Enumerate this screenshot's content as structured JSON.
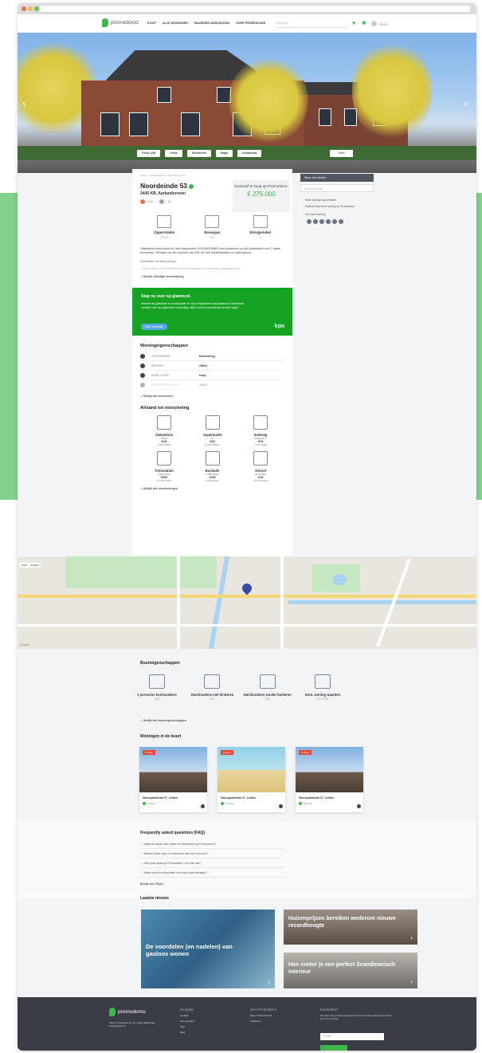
{
  "nav": {
    "logo": "promodomo",
    "menu": [
      "KOOP",
      "ALLE WONINGEN",
      "WAARDEN AANVRAGEN",
      "OVER PROMODOMO"
    ],
    "search_placeholder": "ZOEKEN",
    "account_label": "INLOG"
  },
  "hero": {
    "tabs": [
      "Fotos (25)",
      "Video",
      "Streetview",
      "Maps",
      "Kadastraal"
    ],
    "share": "Delen"
  },
  "listing": {
    "breadcrumb": "Home > Aarlanderveen > Noordeinde > 53",
    "title": "Noordeinde 53",
    "subtitle": "2445 KB, Aarlanderveen",
    "pills": [
      "3 Kls",
      "1 Ks"
    ],
    "price_label": "Exclusief te koop op Promodomo:",
    "price": "€ 275.000",
    "stats": [
      {
        "label": "Oppervlakte",
        "value": "253 m2"
      },
      {
        "label": "Bouwjaar",
        "value": "1912"
      },
      {
        "label": "Energielabel",
        "value": "A"
      }
    ],
    "description": "Uitstekend verbouwde en luxe afgewerkte HOEKWONING met achtertuin op het zuidwesten met 2 fraaie tuinhuizen. Gelegen op een perceel van 253 m2 met parkeerplaats op eigen grond.",
    "desc_head": "Kenmerken van deze woning:",
    "desc_more": "- Vanaf 1909 tot 2019 hebben diverse verbouwingen en renovaties plaatsgevonden",
    "read_more": "Bekijk volledige omschrijving"
  },
  "kpn": {
    "title": "Stap nu over op glasvezel.",
    "body": "Internet via glasvezel is revolutionair. Er zijn al miljoenen huishoudens in Nederland voorzien van een glasvezel verbinding. Wat is dat en wanneerde kennisn slige?",
    "button": "Meer informatie",
    "logo": "kpn"
  },
  "properties": {
    "title": "Woningeigenschappen",
    "rows": [
      {
        "k": "TYPE WONING",
        "v": "Hoekwoning"
      },
      {
        "k": "PERCEEL",
        "v": "253m2"
      },
      {
        "k": "HUUR / KOOP",
        "v": "Koop"
      },
      {
        "k": "WOONOPPERVLAKTE",
        "v": "200m2"
      }
    ],
    "more": "Bekijk alle kenmerken"
  },
  "amenities": {
    "title": "Afstand tot voorziening",
    "items": [
      {
        "name": "Ziekenhuis",
        "sub": "Alrijne",
        "dist": "2KM",
        "time": "3 min fietsen"
      },
      {
        "name": "Supermarkt",
        "sub": "AH",
        "dist": "2KM",
        "time": "6 min fietsen"
      },
      {
        "name": "Snelweg",
        "sub": "Afslag A11",
        "dist": "2KM",
        "time": "2 min rijden"
      },
      {
        "name": "Treinstation",
        "sub": "Ziekenhuis",
        "dist": "800M",
        "time": "10 min lopen"
      },
      {
        "name": "Bushalte",
        "sub": "Halteplaats",
        "dist": "200M",
        "time": "4 min lopen"
      },
      {
        "name": "School",
        "sub": "De Leidse",
        "dist": "1KM",
        "time": "15 min lopen"
      }
    ],
    "more": "Bekijk alle voorzieningen"
  },
  "sidebar": {
    "header": "Stuur een bericht",
    "input": "Stuur een Email",
    "links": [
      "Deze woning is geschakeld",
      "Waarom staat deze woning op Promodomo?"
    ],
    "share": "Deel deze woning"
  },
  "map": {
    "btn1": "Kaart",
    "btn2": "Satelliet",
    "brand": "Google"
  },
  "neighbourhood": {
    "title": "Buurteigenschappen",
    "items": [
      {
        "name": "1 persoons huishoudens",
        "val": "30%"
      },
      {
        "name": "Huishoudens met kinderen",
        "val": "34%"
      },
      {
        "name": "Huishoudens zonder kinderen",
        "val": "34%"
      },
      {
        "name": "Gem. woning waarden",
        "val": "€ 274.000"
      }
    ],
    "more": "Bekijk alle buurteigenschappen"
  },
  "nearby": {
    "title": "Woningen in de buurt",
    "cards": [
      {
        "badge": "Te koop",
        "addr": "Samspadstraat 37, Leiden",
        "status": "Te koop"
      },
      {
        "badge": "Te koop",
        "addr": "Samspadstraat 37, Leiden",
        "status": "Te koop"
      },
      {
        "badge": "Te koop",
        "addr": "Samspadstraat 37, Leiden",
        "status": "Te koop"
      }
    ]
  },
  "faq": {
    "title": "Frequently asked questions (FAQ)",
    "items": [
      "Waarom staan alle huizen in Nederland op Promodomo?",
      "Welke kosten zijn er verbonden aan een account?",
      "Mijn huis staat op Promodomo, hoe kan dat?",
      "Waar komt de informatie over mijn huis vandaan?"
    ],
    "more": "Bekijk alle FAQs"
  },
  "news": {
    "title": "Laatste nieuws",
    "items": [
      "De voordelen (en nadelen) van gasloos wonen",
      "Huizenprijzen bereiken wederom nieuwe recordhoogte",
      "Hoe creëer je een perfect Scandinavisch interieur"
    ]
  },
  "footer": {
    "logo": "promodomo",
    "tagline": "Vind je droomhuis op het meest uitgebreide woningplatform.",
    "nav_head": "Navigatie",
    "nav_items": [
      "Contact",
      "Alle woningen",
      "FAQ",
      "Blog"
    ],
    "about_head": "Over Promodomo",
    "about_items": [
      "Wat is Promodomo?",
      "Vacatures"
    ],
    "news_head": "Nieuwsbrief",
    "news_text": "Op zoek naar je droomwoning? Of juist je woning verkopen? Schrijf je in en mis niets.",
    "email_placeholder": "E-mail"
  }
}
